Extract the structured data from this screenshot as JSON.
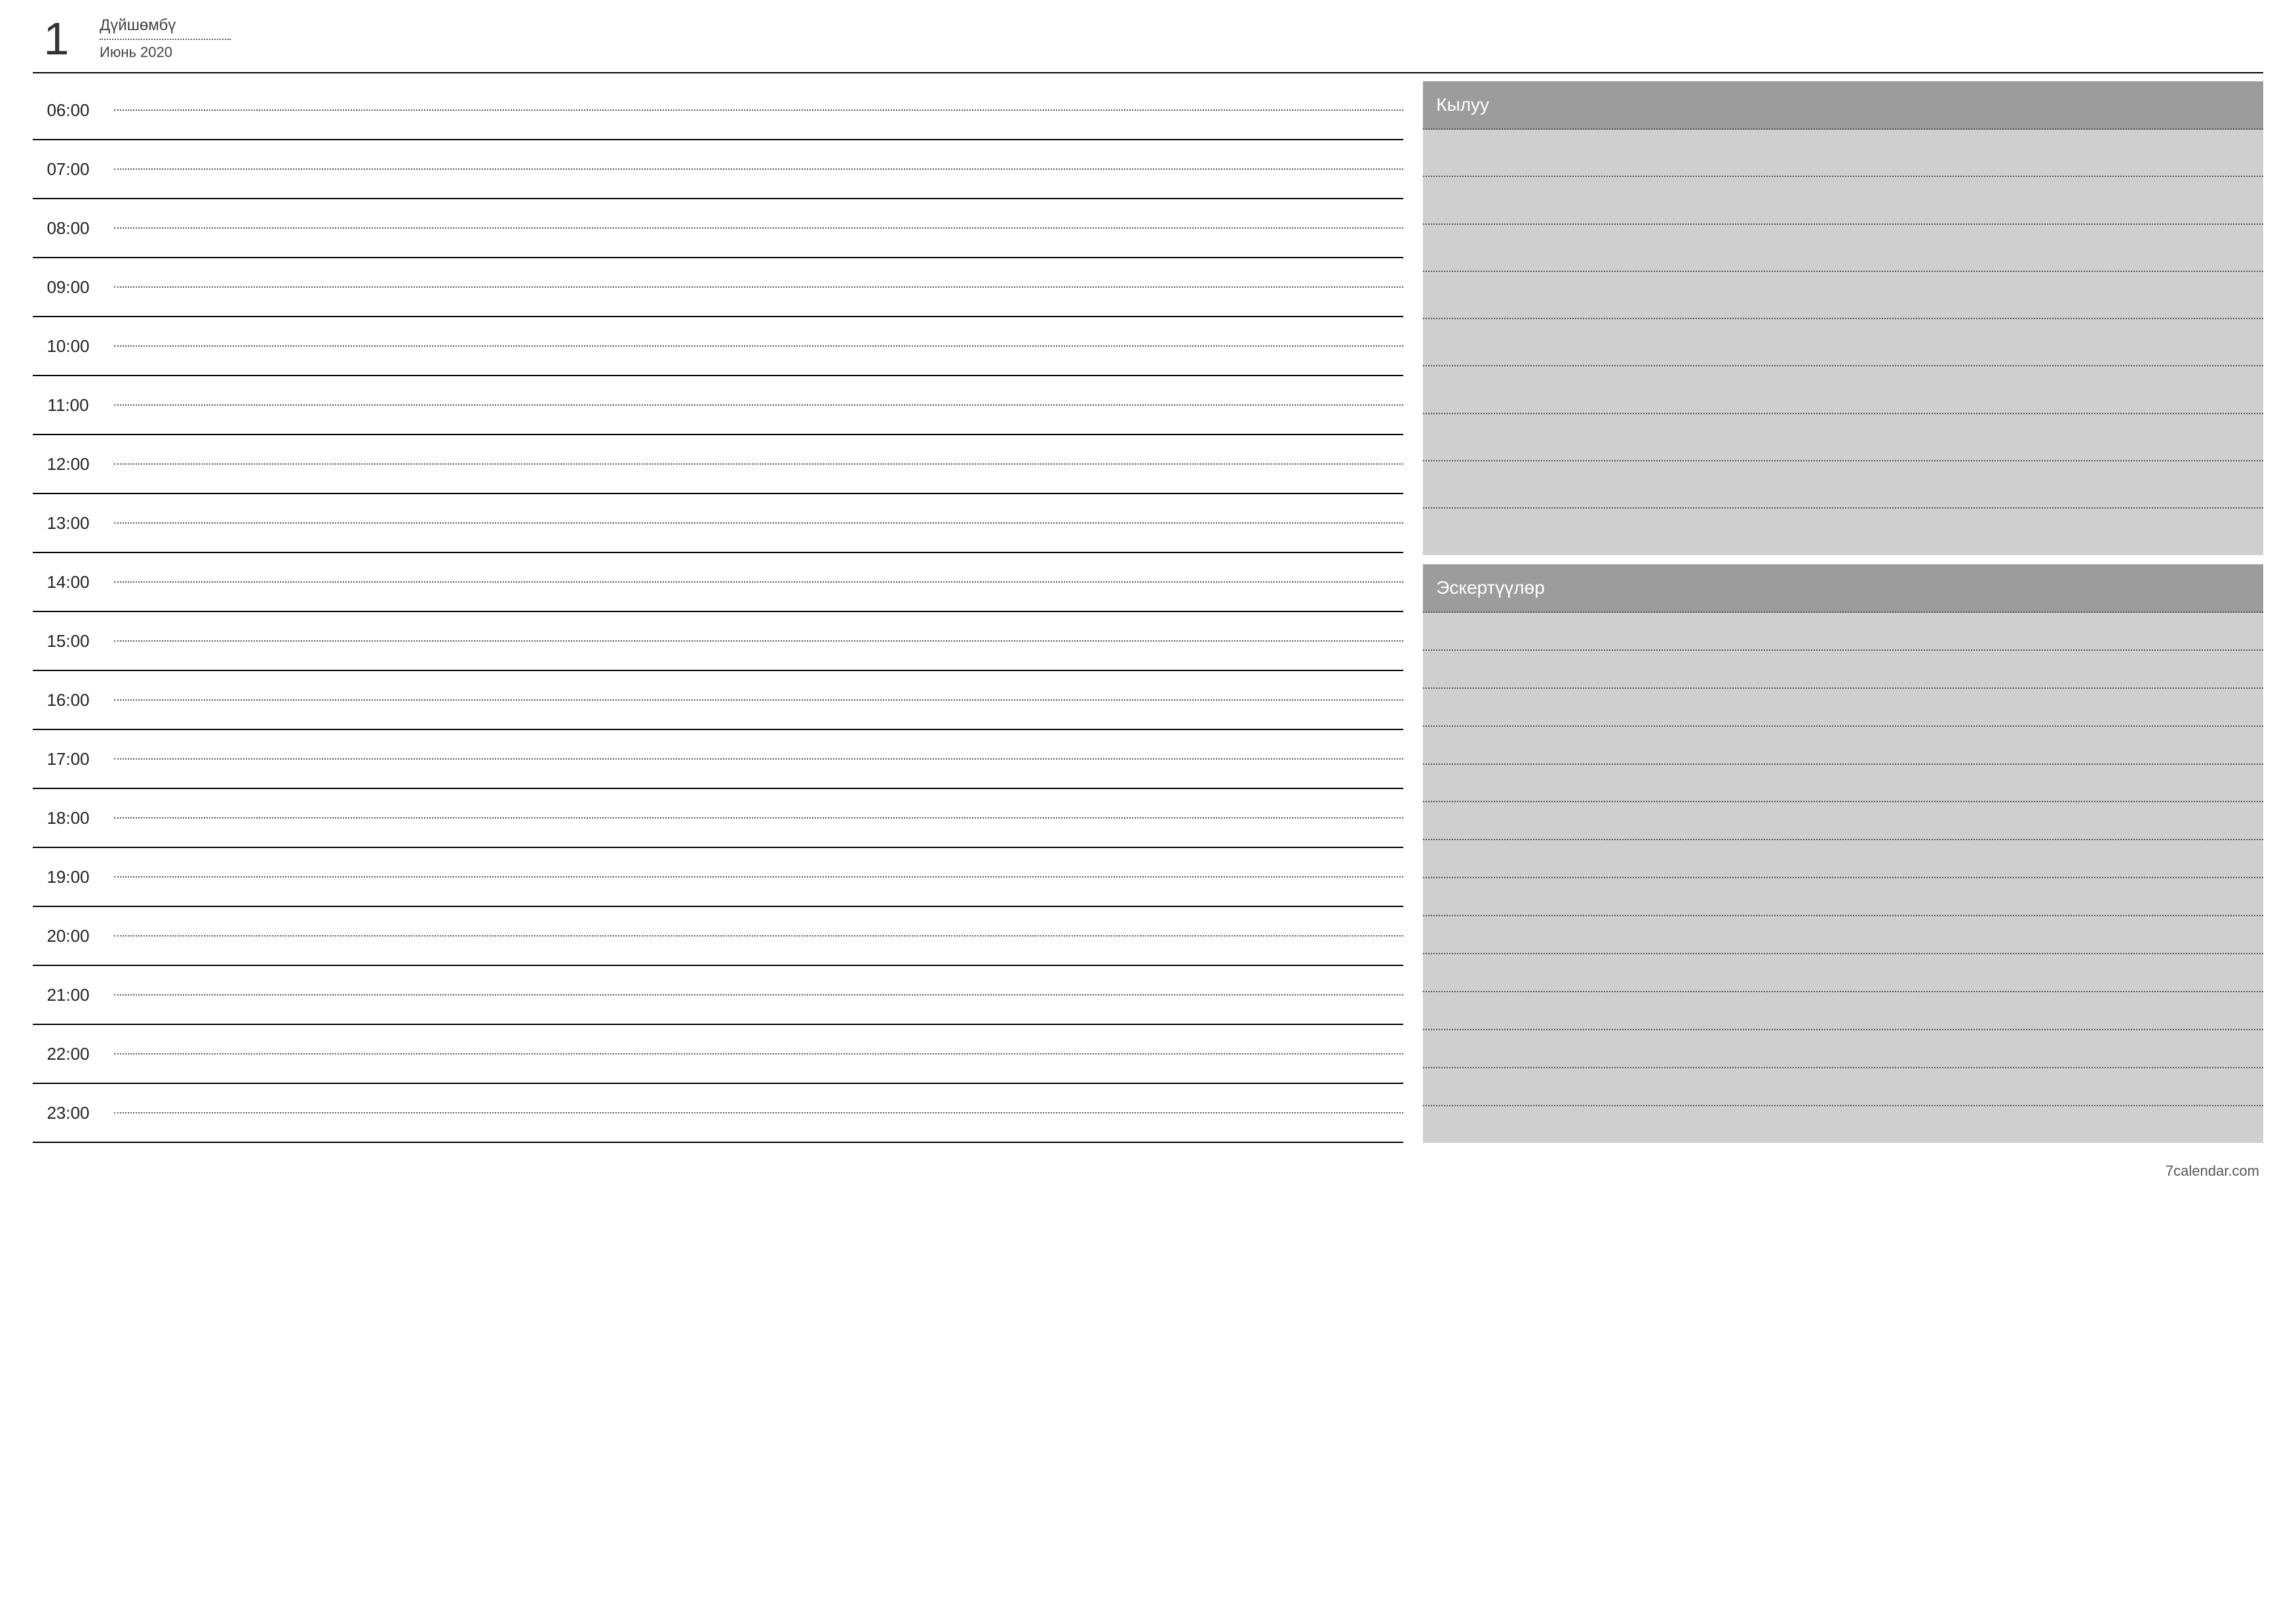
{
  "header": {
    "day_number": "1",
    "day_name": "Дүйшөмбү",
    "month_year": "Июнь 2020"
  },
  "schedule": {
    "hours": [
      "06:00",
      "07:00",
      "08:00",
      "09:00",
      "10:00",
      "11:00",
      "12:00",
      "13:00",
      "14:00",
      "15:00",
      "16:00",
      "17:00",
      "18:00",
      "19:00",
      "20:00",
      "21:00",
      "22:00",
      "23:00"
    ]
  },
  "sidebar": {
    "todo_title": "Кылуу",
    "todo_lines": 9,
    "notes_title": "Эскертүүлөр",
    "notes_lines": 14
  },
  "footer": {
    "site": "7calendar.com"
  }
}
